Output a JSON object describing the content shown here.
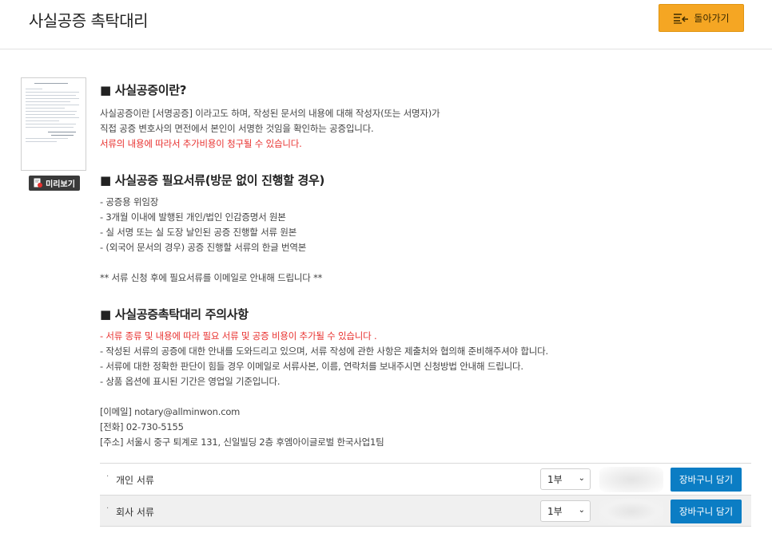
{
  "header": {
    "title": "사실공증 촉탁대리",
    "back_label": "돌아가기"
  },
  "preview": {
    "label": "미리보기"
  },
  "sections": {
    "s1_title": "■ 사실공증이란?",
    "s1_lines": [
      "사실공증이란 [서명공증] 이라고도 하며, 작성된 문서의 내용에 대해 작성자(또는 서명자)가",
      "직접 공증 변호사의 면전에서 본인이 서명한 것임을 확인하는 공증입니다."
    ],
    "s1_note": "서류의 내용에 따라서 추가비용이 청구될 수 있습니다.",
    "s2_title": "■ 사실공증 필요서류(방문 없이 진행할 경우)",
    "s2_lines": [
      "- 공증용 위임장",
      "- 3개월 이내에 발행된 개인/법인 인감증명서 원본",
      "- 실 서명 또는 실 도장 날인된 공증 진행할 서류 원본",
      "- (외국어 문서의 경우) 공증 진행할 서류의 한글 번역본"
    ],
    "s2_note": "** 서류 신청 후에 필요서류를 이메일로 안내해 드립니다 **",
    "s3_title": "■ 사실공증촉탁대리 주의사항",
    "s3_red": "- 서류 종류 및 내용에 따라 필요 서류 및 공증 비용이 추가될 수 있습니다 .",
    "s3_lines": [
      "- 작성된 서류의 공증에 대한 안내를 도와드리고 있으며, 서류 작성에 관한 사항은 제출처와 협의해 준비해주셔야 합니다.",
      "- 서류에 대한 정확한 판단이 힘들 경우 이메일로 서류사본, 이름, 연락처를 보내주시면 신청방법 안내해 드립니다.",
      "- 상품 옵션에 표시된 기간은 영업일 기준입니다."
    ],
    "contact": [
      "[이메일] notary@allminwon.com",
      "[전화] 02-730-5155",
      "[주소] 서울시 중구 퇴계로 131, 신일빌딩 2층 후엠아이글로벌 한국사업1팀"
    ]
  },
  "options": [
    {
      "label": "개인 서류",
      "qty": "1부",
      "cart_label": "장바구니 담기"
    },
    {
      "label": "회사 서류",
      "qty": "1부",
      "cart_label": "장바구니 담기"
    }
  ],
  "colors": {
    "accent": "#f5a623",
    "cart": "#0b7dc4",
    "warning": "#e8312f"
  },
  "icons": {
    "back": "list-back-icon",
    "preview": "document-preview-icon",
    "select": "chevron-down-icon"
  }
}
